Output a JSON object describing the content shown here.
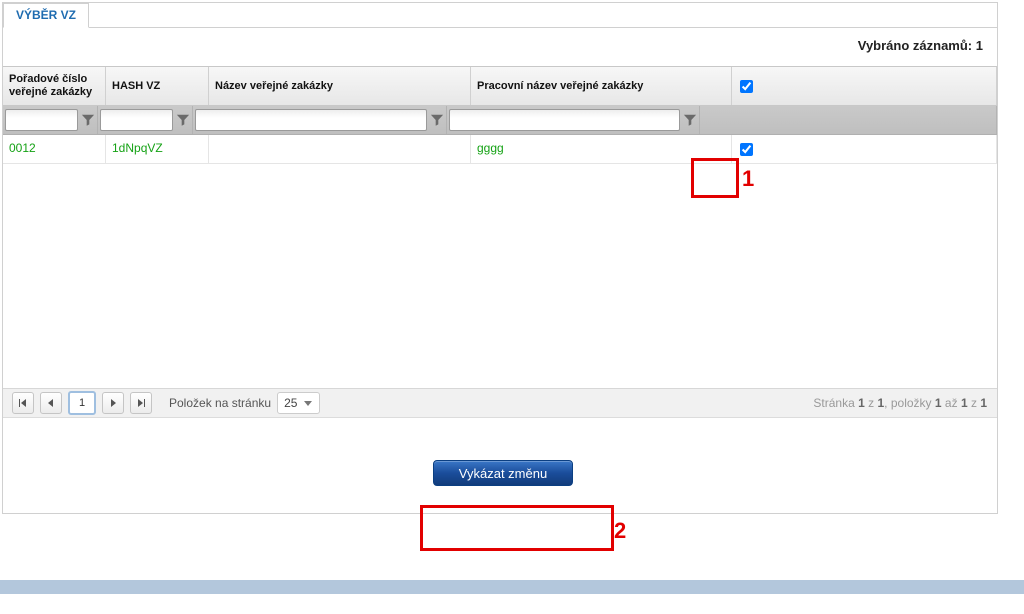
{
  "tab": {
    "label": "VÝBĚR VZ"
  },
  "selected_bar": {
    "label": "Vybráno záznamů:",
    "count": "1"
  },
  "columns": {
    "c0": "Pořadové číslo veřejné zakázky",
    "c1": "HASH VZ",
    "c2": "Název veřejné zakázky",
    "c3": "Pracovní název veřejné zakázky"
  },
  "rows": [
    {
      "order_no": "0012",
      "hash": "1dNpqVZ",
      "name": "",
      "work_name": "gggg",
      "checked": true
    }
  ],
  "pager": {
    "page": "1",
    "page_size_label": "Položek na stránku",
    "page_size": "25",
    "info_prefix": "Stránka",
    "info_page_cur": "1",
    "info_of": "z",
    "info_page_total": "1",
    "info_items_label": ", položky",
    "info_item_from": "1",
    "info_to": "až",
    "info_item_to": "1",
    "info_of2": "z",
    "info_item_total": "1"
  },
  "action": {
    "submit": "Vykázat změnu"
  },
  "callouts": {
    "c1": "1",
    "c2": "2"
  }
}
